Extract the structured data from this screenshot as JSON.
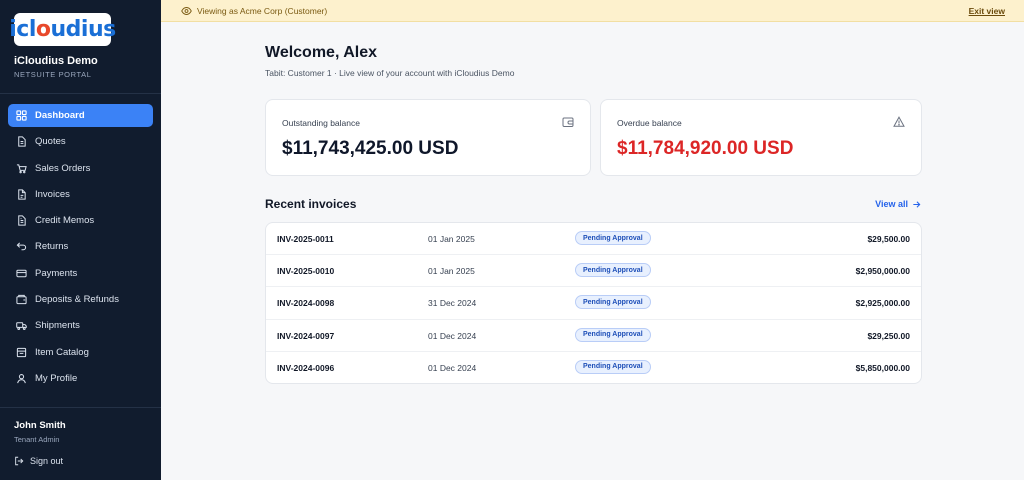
{
  "brand": {
    "logo_text_a": "icl",
    "logo_text_o": "o",
    "logo_text_b": "udius",
    "name": "iCloudius Demo",
    "subtitle": "NETSUITE PORTAL"
  },
  "sidebar": {
    "items": [
      {
        "label": "Dashboard",
        "icon": "dashboard-icon",
        "active": true
      },
      {
        "label": "Quotes",
        "icon": "quote-icon"
      },
      {
        "label": "Sales Orders",
        "icon": "cart-icon"
      },
      {
        "label": "Invoices",
        "icon": "invoice-icon"
      },
      {
        "label": "Credit Memos",
        "icon": "memo-icon"
      },
      {
        "label": "Returns",
        "icon": "return-icon"
      },
      {
        "label": "Payments",
        "icon": "card-icon"
      },
      {
        "label": "Deposits & Refunds",
        "icon": "wallet-icon"
      },
      {
        "label": "Shipments",
        "icon": "truck-icon"
      },
      {
        "label": "Item Catalog",
        "icon": "catalog-icon"
      },
      {
        "label": "My Profile",
        "icon": "user-icon"
      }
    ]
  },
  "user": {
    "name": "John Smith",
    "role": "Tenant Admin",
    "signout_label": "Sign out"
  },
  "banner": {
    "text": "Viewing as Acme Corp (Customer)",
    "exit_label": "Exit view"
  },
  "main": {
    "welcome": "Welcome, Alex",
    "subtitle": "Tabit: Customer 1 · Live view of your account with iCloudius Demo",
    "outstanding": {
      "label": "Outstanding balance",
      "value": "$11,743,425.00 USD"
    },
    "overdue": {
      "label": "Overdue balance",
      "value": "$11,784,920.00 USD"
    },
    "recent_title": "Recent invoices",
    "view_all_label": "View all",
    "invoices": [
      {
        "number": "INV-2025-0011",
        "date": "01 Jan 2025",
        "status": "Pending Approval",
        "amount": "$29,500.00"
      },
      {
        "number": "INV-2025-0010",
        "date": "01 Jan 2025",
        "status": "Pending Approval",
        "amount": "$2,950,000.00"
      },
      {
        "number": "INV-2024-0098",
        "date": "31 Dec 2024",
        "status": "Pending Approval",
        "amount": "$2,925,000.00"
      },
      {
        "number": "INV-2024-0097",
        "date": "01 Dec 2024",
        "status": "Pending Approval",
        "amount": "$29,250.00"
      },
      {
        "number": "INV-2024-0096",
        "date": "01 Dec 2024",
        "status": "Pending Approval",
        "amount": "$5,850,000.00"
      }
    ]
  },
  "colors": {
    "sidebar_bg": "#111c2e",
    "accent": "#3b82f6",
    "overdue": "#dc2626",
    "banner_bg": "#fdf1cd"
  }
}
